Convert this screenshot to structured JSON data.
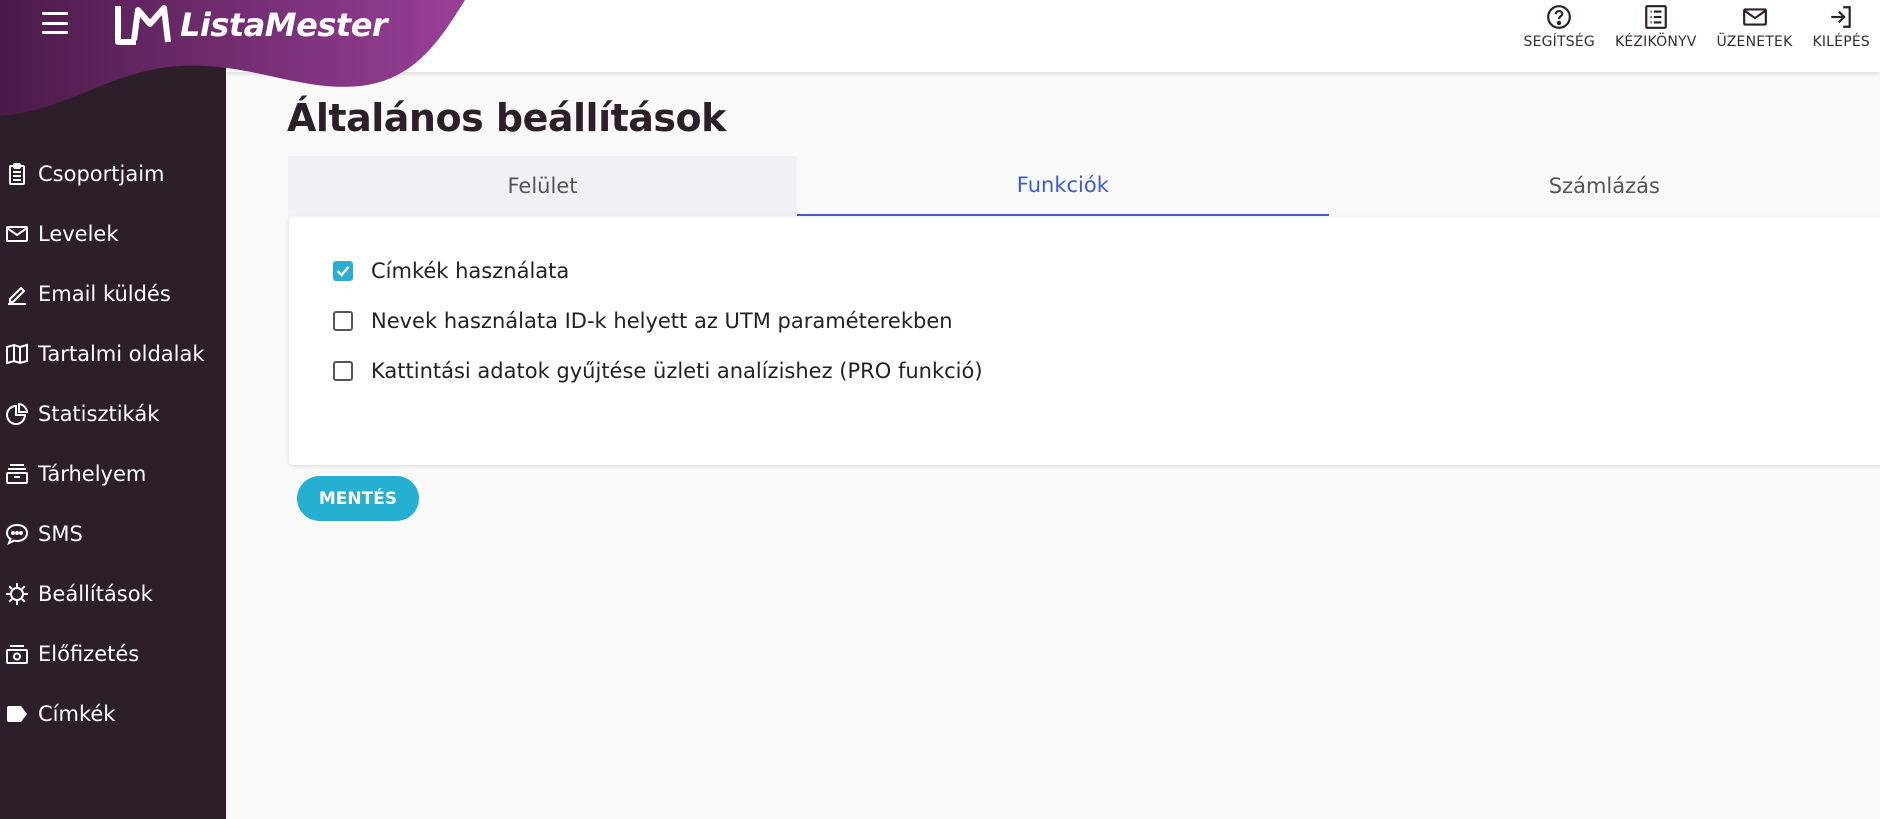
{
  "app": {
    "brand": "ListaMester"
  },
  "colors": {
    "sidebar": "#2c1f2a",
    "accent": "#25afd0",
    "tab_active": "#3b5bdb",
    "logo_gradient": [
      "#4a1a49",
      "#9a3f98"
    ]
  },
  "sidebar": {
    "items": [
      {
        "label": "Csoportjaim",
        "icon": "clipboard-list-icon"
      },
      {
        "label": "Levelek",
        "icon": "envelope-icon"
      },
      {
        "label": "Email küldés",
        "icon": "pencil-icon"
      },
      {
        "label": "Tartalmi oldalak",
        "icon": "book-open-icon"
      },
      {
        "label": "Statisztikák",
        "icon": "pie-chart-icon"
      },
      {
        "label": "Tárhelyem",
        "icon": "archive-icon"
      },
      {
        "label": "SMS",
        "icon": "chat-bubble-icon"
      },
      {
        "label": "Beállítások",
        "icon": "gear-icon"
      },
      {
        "label": "Előfizetés",
        "icon": "money-icon"
      },
      {
        "label": "Címkék",
        "icon": "tag-icon"
      }
    ]
  },
  "topbar": {
    "actions": [
      {
        "label": "SEGÍTSÉG",
        "icon": "help-circle-icon"
      },
      {
        "label": "KÉZIKÖNYV",
        "icon": "manual-list-icon"
      },
      {
        "label": "ÜZENETEK",
        "icon": "mail-icon"
      },
      {
        "label": "KILÉPÉS",
        "icon": "logout-icon"
      }
    ]
  },
  "main": {
    "title": "Általános beállítások",
    "tabs": [
      {
        "label": "Felület",
        "active": false
      },
      {
        "label": "Funkciók",
        "active": true
      },
      {
        "label": "Számlázás",
        "active": false
      }
    ],
    "options": [
      {
        "label": "Címkék használata",
        "checked": true
      },
      {
        "label": "Nevek használata ID-k helyett az UTM paraméterekben",
        "checked": false
      },
      {
        "label": "Kattintási adatok gyűjtése üzleti analízishez (PRO funkció)",
        "checked": false
      }
    ],
    "save_label": "MENTÉS"
  }
}
